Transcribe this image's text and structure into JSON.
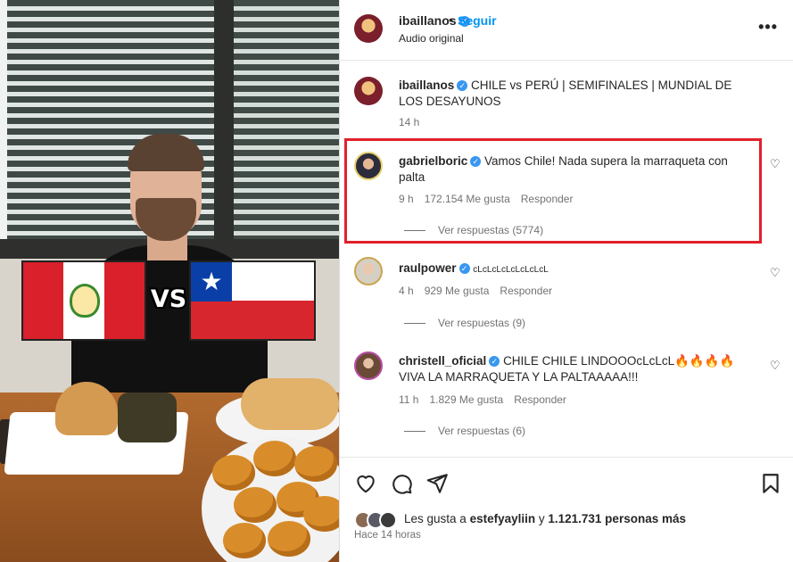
{
  "post_header": {
    "username": "ibaillanos",
    "follow_label": "Seguir",
    "separator": "•",
    "audio_label": "Audio original",
    "more_icon": "more-horizontal-icon"
  },
  "caption": {
    "username": "ibaillanos",
    "text": "CHILE vs PERÚ | SEMIFINALES | MUNDIAL DE LOS DESAYUNOS",
    "time": "14 h"
  },
  "video": {
    "vs_label": "VS"
  },
  "comments": [
    {
      "username": "gabrielboric",
      "text": "Vamos Chile! Nada supera la marraqueta con palta",
      "time": "9 h",
      "likes": "172.154 Me gusta",
      "reply_label": "Responder",
      "view_replies": "Ver respuestas (5774)"
    },
    {
      "username": "raulpower",
      "text": "cLcLcLcLcLcLcLcL",
      "time": "4 h",
      "likes": "929 Me gusta",
      "reply_label": "Responder",
      "view_replies": "Ver respuestas (9)"
    },
    {
      "username": "christell_oficial",
      "text": "CHILE CHILE LINDOOOcLcLcL🔥🔥🔥🔥 VIVA LA MARRAQUETA Y LA PALTAAAAA!!!",
      "time": "11 h",
      "likes": "1.829 Me gusta",
      "reply_label": "Responder",
      "view_replies": "Ver respuestas (6)"
    }
  ],
  "footer": {
    "likes_prefix": "Les gusta a ",
    "likes_user": "estefyayliin",
    "likes_middle": " y ",
    "likes_count": "1.121.731 personas más",
    "posted_ago": "Hace 14 horas"
  },
  "colors": {
    "accent": "#0095f6",
    "verified": "#3897f0",
    "highlight_border": "#e0202a"
  }
}
